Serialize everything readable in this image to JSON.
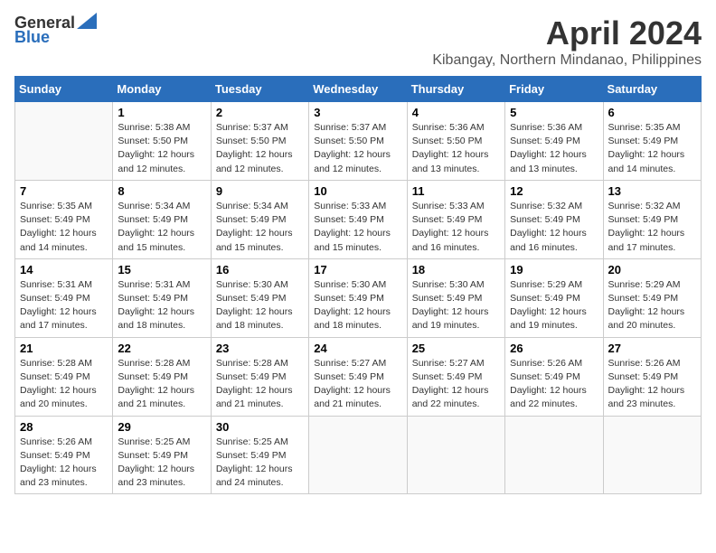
{
  "header": {
    "logo_line1": "General",
    "logo_line2": "Blue",
    "month": "April 2024",
    "location": "Kibangay, Northern Mindanao, Philippines"
  },
  "days_of_week": [
    "Sunday",
    "Monday",
    "Tuesday",
    "Wednesday",
    "Thursday",
    "Friday",
    "Saturday"
  ],
  "weeks": [
    [
      {
        "day": "",
        "info": ""
      },
      {
        "day": "1",
        "info": "Sunrise: 5:38 AM\nSunset: 5:50 PM\nDaylight: 12 hours\nand 12 minutes."
      },
      {
        "day": "2",
        "info": "Sunrise: 5:37 AM\nSunset: 5:50 PM\nDaylight: 12 hours\nand 12 minutes."
      },
      {
        "day": "3",
        "info": "Sunrise: 5:37 AM\nSunset: 5:50 PM\nDaylight: 12 hours\nand 12 minutes."
      },
      {
        "day": "4",
        "info": "Sunrise: 5:36 AM\nSunset: 5:50 PM\nDaylight: 12 hours\nand 13 minutes."
      },
      {
        "day": "5",
        "info": "Sunrise: 5:36 AM\nSunset: 5:49 PM\nDaylight: 12 hours\nand 13 minutes."
      },
      {
        "day": "6",
        "info": "Sunrise: 5:35 AM\nSunset: 5:49 PM\nDaylight: 12 hours\nand 14 minutes."
      }
    ],
    [
      {
        "day": "7",
        "info": "Sunrise: 5:35 AM\nSunset: 5:49 PM\nDaylight: 12 hours\nand 14 minutes."
      },
      {
        "day": "8",
        "info": "Sunrise: 5:34 AM\nSunset: 5:49 PM\nDaylight: 12 hours\nand 15 minutes."
      },
      {
        "day": "9",
        "info": "Sunrise: 5:34 AM\nSunset: 5:49 PM\nDaylight: 12 hours\nand 15 minutes."
      },
      {
        "day": "10",
        "info": "Sunrise: 5:33 AM\nSunset: 5:49 PM\nDaylight: 12 hours\nand 15 minutes."
      },
      {
        "day": "11",
        "info": "Sunrise: 5:33 AM\nSunset: 5:49 PM\nDaylight: 12 hours\nand 16 minutes."
      },
      {
        "day": "12",
        "info": "Sunrise: 5:32 AM\nSunset: 5:49 PM\nDaylight: 12 hours\nand 16 minutes."
      },
      {
        "day": "13",
        "info": "Sunrise: 5:32 AM\nSunset: 5:49 PM\nDaylight: 12 hours\nand 17 minutes."
      }
    ],
    [
      {
        "day": "14",
        "info": "Sunrise: 5:31 AM\nSunset: 5:49 PM\nDaylight: 12 hours\nand 17 minutes."
      },
      {
        "day": "15",
        "info": "Sunrise: 5:31 AM\nSunset: 5:49 PM\nDaylight: 12 hours\nand 18 minutes."
      },
      {
        "day": "16",
        "info": "Sunrise: 5:30 AM\nSunset: 5:49 PM\nDaylight: 12 hours\nand 18 minutes."
      },
      {
        "day": "17",
        "info": "Sunrise: 5:30 AM\nSunset: 5:49 PM\nDaylight: 12 hours\nand 18 minutes."
      },
      {
        "day": "18",
        "info": "Sunrise: 5:30 AM\nSunset: 5:49 PM\nDaylight: 12 hours\nand 19 minutes."
      },
      {
        "day": "19",
        "info": "Sunrise: 5:29 AM\nSunset: 5:49 PM\nDaylight: 12 hours\nand 19 minutes."
      },
      {
        "day": "20",
        "info": "Sunrise: 5:29 AM\nSunset: 5:49 PM\nDaylight: 12 hours\nand 20 minutes."
      }
    ],
    [
      {
        "day": "21",
        "info": "Sunrise: 5:28 AM\nSunset: 5:49 PM\nDaylight: 12 hours\nand 20 minutes."
      },
      {
        "day": "22",
        "info": "Sunrise: 5:28 AM\nSunset: 5:49 PM\nDaylight: 12 hours\nand 21 minutes."
      },
      {
        "day": "23",
        "info": "Sunrise: 5:28 AM\nSunset: 5:49 PM\nDaylight: 12 hours\nand 21 minutes."
      },
      {
        "day": "24",
        "info": "Sunrise: 5:27 AM\nSunset: 5:49 PM\nDaylight: 12 hours\nand 21 minutes."
      },
      {
        "day": "25",
        "info": "Sunrise: 5:27 AM\nSunset: 5:49 PM\nDaylight: 12 hours\nand 22 minutes."
      },
      {
        "day": "26",
        "info": "Sunrise: 5:26 AM\nSunset: 5:49 PM\nDaylight: 12 hours\nand 22 minutes."
      },
      {
        "day": "27",
        "info": "Sunrise: 5:26 AM\nSunset: 5:49 PM\nDaylight: 12 hours\nand 23 minutes."
      }
    ],
    [
      {
        "day": "28",
        "info": "Sunrise: 5:26 AM\nSunset: 5:49 PM\nDaylight: 12 hours\nand 23 minutes."
      },
      {
        "day": "29",
        "info": "Sunrise: 5:25 AM\nSunset: 5:49 PM\nDaylight: 12 hours\nand 23 minutes."
      },
      {
        "day": "30",
        "info": "Sunrise: 5:25 AM\nSunset: 5:49 PM\nDaylight: 12 hours\nand 24 minutes."
      },
      {
        "day": "",
        "info": ""
      },
      {
        "day": "",
        "info": ""
      },
      {
        "day": "",
        "info": ""
      },
      {
        "day": "",
        "info": ""
      }
    ]
  ]
}
